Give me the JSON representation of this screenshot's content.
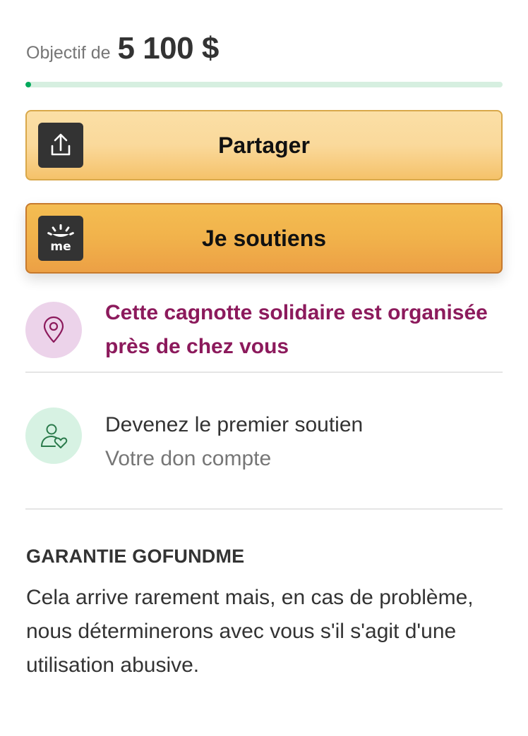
{
  "goal": {
    "label": "Objectif de",
    "amount": "5 100 $",
    "progress_fraction": 0.0,
    "track_color": "#d6efe0",
    "fill_color": "#02a95c"
  },
  "buttons": {
    "share": {
      "label": "Partager",
      "icon": "share-upload-icon"
    },
    "donate": {
      "label": "Je soutiens",
      "icon": "gofundme-me-logo-icon"
    }
  },
  "local": {
    "text": "Cette cagnotte solidaire est organisée près de chez vous",
    "icon": "location-pin-icon",
    "color": "#8c1a5c"
  },
  "first_supporter": {
    "title": "Devenez le premier soutien",
    "subtitle": "Votre don compte",
    "icon": "person-heart-icon"
  },
  "guarantee": {
    "title": "GARANTIE GOFUNDME",
    "body": "Cela arrive rarement mais, en cas de problème, nous déterminerons avec vous s'il s'agit d'une utilisation abusive."
  }
}
